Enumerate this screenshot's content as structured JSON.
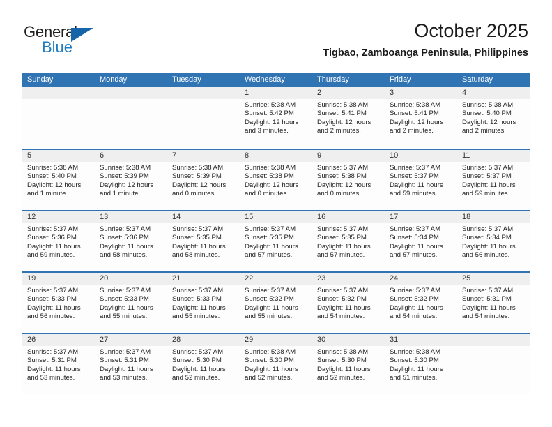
{
  "brand": {
    "name_top": "General",
    "name_bottom": "Blue",
    "accent_color": "#1f7cc1"
  },
  "header": {
    "title": "October 2025",
    "subtitle": "Tigbao, Zamboanga Peninsula, Philippines"
  },
  "theme": {
    "header_blue": "#3174b4",
    "day_band_gray": "#efefef",
    "text_color": "#222222"
  },
  "calendar": {
    "weekday_headers": [
      "Sunday",
      "Monday",
      "Tuesday",
      "Wednesday",
      "Thursday",
      "Friday",
      "Saturday"
    ],
    "weeks": [
      [
        {
          "day": "",
          "empty": true
        },
        {
          "day": "",
          "empty": true
        },
        {
          "day": "",
          "empty": true
        },
        {
          "day": "1",
          "sunrise": "Sunrise: 5:38 AM",
          "sunset": "Sunset: 5:42 PM",
          "daylight1": "Daylight: 12 hours",
          "daylight2": "and 3 minutes."
        },
        {
          "day": "2",
          "sunrise": "Sunrise: 5:38 AM",
          "sunset": "Sunset: 5:41 PM",
          "daylight1": "Daylight: 12 hours",
          "daylight2": "and 2 minutes."
        },
        {
          "day": "3",
          "sunrise": "Sunrise: 5:38 AM",
          "sunset": "Sunset: 5:41 PM",
          "daylight1": "Daylight: 12 hours",
          "daylight2": "and 2 minutes."
        },
        {
          "day": "4",
          "sunrise": "Sunrise: 5:38 AM",
          "sunset": "Sunset: 5:40 PM",
          "daylight1": "Daylight: 12 hours",
          "daylight2": "and 2 minutes."
        }
      ],
      [
        {
          "day": "5",
          "sunrise": "Sunrise: 5:38 AM",
          "sunset": "Sunset: 5:40 PM",
          "daylight1": "Daylight: 12 hours",
          "daylight2": "and 1 minute."
        },
        {
          "day": "6",
          "sunrise": "Sunrise: 5:38 AM",
          "sunset": "Sunset: 5:39 PM",
          "daylight1": "Daylight: 12 hours",
          "daylight2": "and 1 minute."
        },
        {
          "day": "7",
          "sunrise": "Sunrise: 5:38 AM",
          "sunset": "Sunset: 5:39 PM",
          "daylight1": "Daylight: 12 hours",
          "daylight2": "and 0 minutes."
        },
        {
          "day": "8",
          "sunrise": "Sunrise: 5:38 AM",
          "sunset": "Sunset: 5:38 PM",
          "daylight1": "Daylight: 12 hours",
          "daylight2": "and 0 minutes."
        },
        {
          "day": "9",
          "sunrise": "Sunrise: 5:37 AM",
          "sunset": "Sunset: 5:38 PM",
          "daylight1": "Daylight: 12 hours",
          "daylight2": "and 0 minutes."
        },
        {
          "day": "10",
          "sunrise": "Sunrise: 5:37 AM",
          "sunset": "Sunset: 5:37 PM",
          "daylight1": "Daylight: 11 hours",
          "daylight2": "and 59 minutes."
        },
        {
          "day": "11",
          "sunrise": "Sunrise: 5:37 AM",
          "sunset": "Sunset: 5:37 PM",
          "daylight1": "Daylight: 11 hours",
          "daylight2": "and 59 minutes."
        }
      ],
      [
        {
          "day": "12",
          "sunrise": "Sunrise: 5:37 AM",
          "sunset": "Sunset: 5:36 PM",
          "daylight1": "Daylight: 11 hours",
          "daylight2": "and 59 minutes."
        },
        {
          "day": "13",
          "sunrise": "Sunrise: 5:37 AM",
          "sunset": "Sunset: 5:36 PM",
          "daylight1": "Daylight: 11 hours",
          "daylight2": "and 58 minutes."
        },
        {
          "day": "14",
          "sunrise": "Sunrise: 5:37 AM",
          "sunset": "Sunset: 5:35 PM",
          "daylight1": "Daylight: 11 hours",
          "daylight2": "and 58 minutes."
        },
        {
          "day": "15",
          "sunrise": "Sunrise: 5:37 AM",
          "sunset": "Sunset: 5:35 PM",
          "daylight1": "Daylight: 11 hours",
          "daylight2": "and 57 minutes."
        },
        {
          "day": "16",
          "sunrise": "Sunrise: 5:37 AM",
          "sunset": "Sunset: 5:35 PM",
          "daylight1": "Daylight: 11 hours",
          "daylight2": "and 57 minutes."
        },
        {
          "day": "17",
          "sunrise": "Sunrise: 5:37 AM",
          "sunset": "Sunset: 5:34 PM",
          "daylight1": "Daylight: 11 hours",
          "daylight2": "and 57 minutes."
        },
        {
          "day": "18",
          "sunrise": "Sunrise: 5:37 AM",
          "sunset": "Sunset: 5:34 PM",
          "daylight1": "Daylight: 11 hours",
          "daylight2": "and 56 minutes."
        }
      ],
      [
        {
          "day": "19",
          "sunrise": "Sunrise: 5:37 AM",
          "sunset": "Sunset: 5:33 PM",
          "daylight1": "Daylight: 11 hours",
          "daylight2": "and 56 minutes."
        },
        {
          "day": "20",
          "sunrise": "Sunrise: 5:37 AM",
          "sunset": "Sunset: 5:33 PM",
          "daylight1": "Daylight: 11 hours",
          "daylight2": "and 55 minutes."
        },
        {
          "day": "21",
          "sunrise": "Sunrise: 5:37 AM",
          "sunset": "Sunset: 5:33 PM",
          "daylight1": "Daylight: 11 hours",
          "daylight2": "and 55 minutes."
        },
        {
          "day": "22",
          "sunrise": "Sunrise: 5:37 AM",
          "sunset": "Sunset: 5:32 PM",
          "daylight1": "Daylight: 11 hours",
          "daylight2": "and 55 minutes."
        },
        {
          "day": "23",
          "sunrise": "Sunrise: 5:37 AM",
          "sunset": "Sunset: 5:32 PM",
          "daylight1": "Daylight: 11 hours",
          "daylight2": "and 54 minutes."
        },
        {
          "day": "24",
          "sunrise": "Sunrise: 5:37 AM",
          "sunset": "Sunset: 5:32 PM",
          "daylight1": "Daylight: 11 hours",
          "daylight2": "and 54 minutes."
        },
        {
          "day": "25",
          "sunrise": "Sunrise: 5:37 AM",
          "sunset": "Sunset: 5:31 PM",
          "daylight1": "Daylight: 11 hours",
          "daylight2": "and 54 minutes."
        }
      ],
      [
        {
          "day": "26",
          "sunrise": "Sunrise: 5:37 AM",
          "sunset": "Sunset: 5:31 PM",
          "daylight1": "Daylight: 11 hours",
          "daylight2": "and 53 minutes."
        },
        {
          "day": "27",
          "sunrise": "Sunrise: 5:37 AM",
          "sunset": "Sunset: 5:31 PM",
          "daylight1": "Daylight: 11 hours",
          "daylight2": "and 53 minutes."
        },
        {
          "day": "28",
          "sunrise": "Sunrise: 5:37 AM",
          "sunset": "Sunset: 5:30 PM",
          "daylight1": "Daylight: 11 hours",
          "daylight2": "and 52 minutes."
        },
        {
          "day": "29",
          "sunrise": "Sunrise: 5:38 AM",
          "sunset": "Sunset: 5:30 PM",
          "daylight1": "Daylight: 11 hours",
          "daylight2": "and 52 minutes."
        },
        {
          "day": "30",
          "sunrise": "Sunrise: 5:38 AM",
          "sunset": "Sunset: 5:30 PM",
          "daylight1": "Daylight: 11 hours",
          "daylight2": "and 52 minutes."
        },
        {
          "day": "31",
          "sunrise": "Sunrise: 5:38 AM",
          "sunset": "Sunset: 5:30 PM",
          "daylight1": "Daylight: 11 hours",
          "daylight2": "and 51 minutes."
        },
        {
          "day": "",
          "empty": true
        }
      ]
    ]
  }
}
